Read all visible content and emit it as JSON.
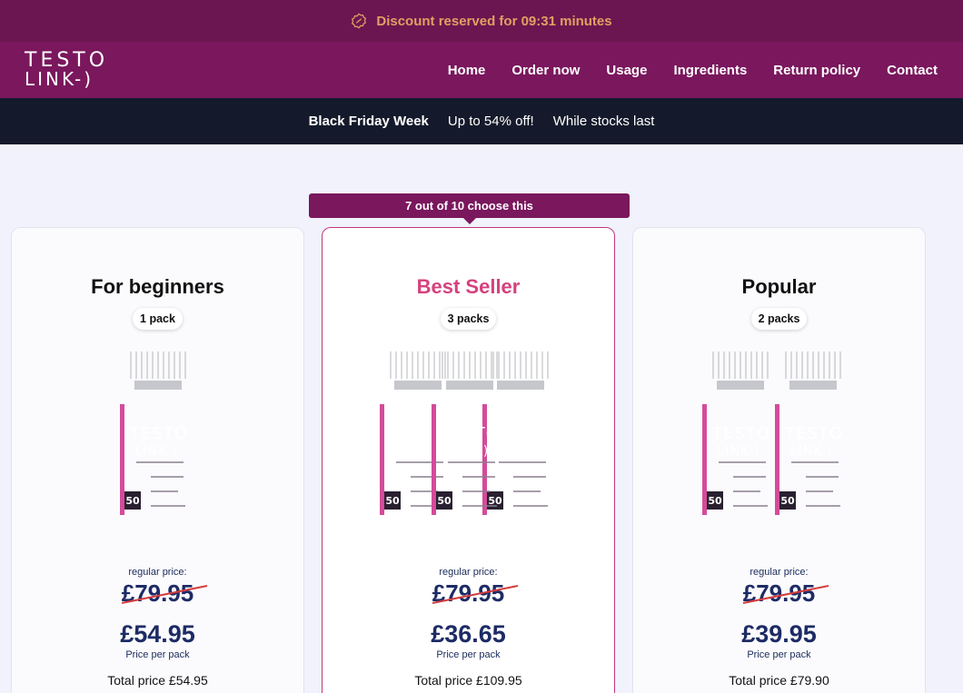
{
  "topbar": {
    "message": "Discount reserved for 09:31 minutes"
  },
  "nav": {
    "logo_line1": "TESTO",
    "logo_line2": "LINK-)",
    "items": [
      "Home",
      "Order now",
      "Usage",
      "Ingredients",
      "Return policy",
      "Contact"
    ]
  },
  "promo": {
    "title": "Black Friday Week",
    "offer": "Up to 54% off!",
    "note": "While stocks last"
  },
  "featured_badge": "7 out of 10 choose this",
  "bottle_label": {
    "brand1": "TESTO",
    "brand2": "LINK-)",
    "caps": "50"
  },
  "cards": [
    {
      "title": "For beginners",
      "pack": "1 pack",
      "regular_label": "regular price:",
      "old_price": "£79.95",
      "price": "£54.95",
      "price_note": "Price per pack",
      "total": "Total price £54.95"
    },
    {
      "title": "Best Seller",
      "pack": "3 packs",
      "regular_label": "regular price:",
      "old_price": "£79.95",
      "price": "£36.65",
      "price_note": "Price per pack",
      "total": "Total price £109.95"
    },
    {
      "title": "Popular",
      "pack": "2 packs",
      "regular_label": "regular price:",
      "old_price": "£79.95",
      "price": "£39.95",
      "price_note": "Price per pack",
      "total": "Total price £79.90"
    }
  ],
  "colors": {
    "brand": "#7a175d",
    "accent": "#d4427e",
    "timer": "#e0a064",
    "price": "#1d2b65"
  }
}
